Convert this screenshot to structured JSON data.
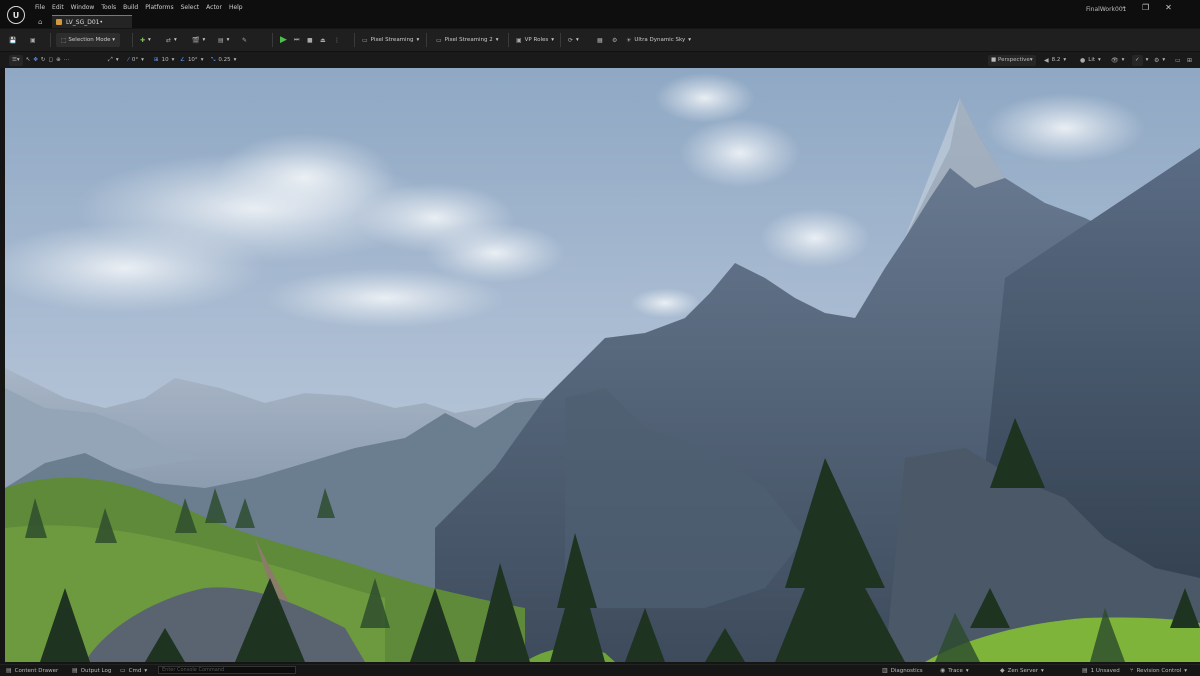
{
  "app": {
    "logo_glyph": "U",
    "project_name": "FinalWork001"
  },
  "menu": [
    "File",
    "Edit",
    "Window",
    "Tools",
    "Build",
    "Platforms",
    "Select",
    "Actor",
    "Help"
  ],
  "tab": {
    "label": "LV_SG_D01•",
    "home_icon": "home-icon"
  },
  "window_buttons": [
    "–",
    "❐",
    "✕"
  ],
  "toolbar": {
    "selection_mode": "Selection Mode",
    "pixel_streaming": "Pixel Streaming",
    "pixel_streaming_2": "Pixel Streaming 2",
    "vp_roles": "VP Roles",
    "ultra_dynamic_sky": "Ultra Dynamic Sky"
  },
  "viewport_toolbar": {
    "snap_rotation": "0°",
    "grid": "10",
    "angle": "10°",
    "scale": "0.25",
    "perspective": "Perspective",
    "fov": "8.2",
    "lit": "Lit"
  },
  "statusbar": {
    "content_drawer": "Content Drawer",
    "output_log": "Output Log",
    "cmd": "Cmd",
    "console_placeholder": "Enter Console Command",
    "diagnostics": "Diagnostics",
    "trace": "Trace",
    "zen_server": "Zen Server",
    "unsaved": "1 Unsaved",
    "revision_control": "Revision Control"
  },
  "colors": {
    "accent": "#4d7ecf",
    "play": "#4cc04c",
    "sky_top": "#a9bfd8",
    "grass": "#7fb43a"
  }
}
